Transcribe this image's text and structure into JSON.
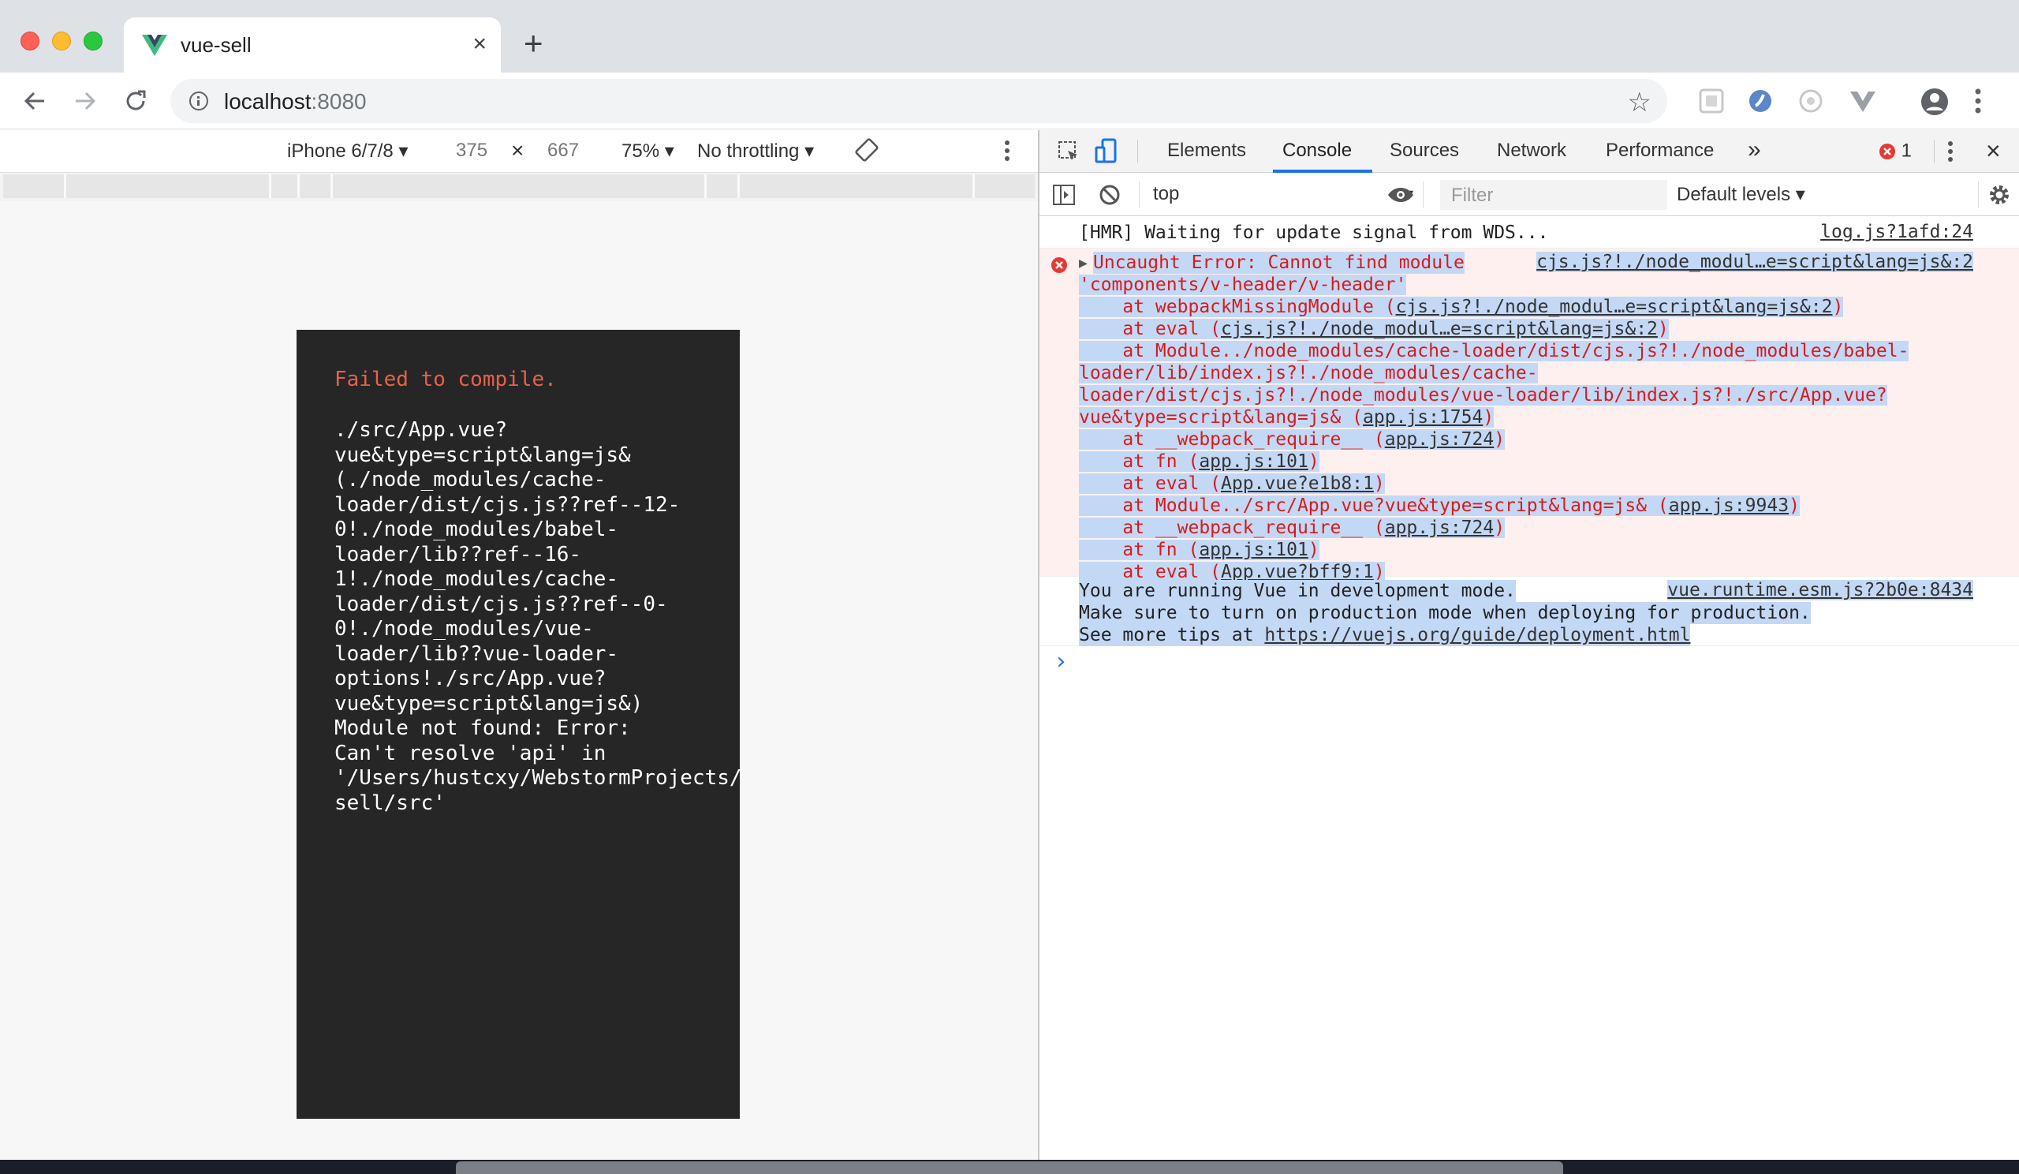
{
  "browser": {
    "tab_title": "vue-sell",
    "url_host": "localhost",
    "url_port": ":8080"
  },
  "device_toolbar": {
    "device": "iPhone 6/7/8",
    "width": "375",
    "times": "×",
    "height": "667",
    "zoom": "75%",
    "throttle": "No throttling"
  },
  "overlay": {
    "title": "Failed to compile.",
    "message": "./src/App.vue?\nvue&type=script&lang=js&\n(./node_modules/cache-\nloader/dist/cjs.js??ref--12-\n0!./node_modules/babel-\nloader/lib??ref--16-\n1!./node_modules/cache-\nloader/dist/cjs.js??ref--0-\n0!./node_modules/vue-\nloader/lib??vue-loader-\noptions!./src/App.vue?\nvue&type=script&lang=js&)\nModule not found: Error:\nCan't resolve 'api' in\n'/Users/hustcxy/WebstormProjects/vue-\nsell/src'"
  },
  "devtools": {
    "tabs": [
      "Elements",
      "Console",
      "Sources",
      "Network",
      "Performance"
    ],
    "more": "»",
    "error_count": "1",
    "context": "top",
    "filter_placeholder": "Filter",
    "levels": "Default levels"
  },
  "console": {
    "hmr": {
      "text": "[HMR] Waiting for update signal from WDS...",
      "source": "log.js?1afd:24"
    },
    "error": {
      "head": "Uncaught Error: Cannot find module",
      "head_source": "cjs.js?!./node_modul…e=script&lang=js&:2",
      "lines": [
        {
          "pre": "'components/v-header/v-header'",
          "link": "",
          "post": ""
        },
        {
          "pre": "    at webpackMissingModule (",
          "link": "cjs.js?!./node_modul…e=script&lang=js&:2",
          "post": ")"
        },
        {
          "pre": "    at eval (",
          "link": "cjs.js?!./node_modul…e=script&lang=js&:2",
          "post": ")"
        },
        {
          "pre": "    at Module../node_modules/cache-loader/dist/cjs.js?!./node_modules/babel-",
          "link": "",
          "post": ""
        },
        {
          "pre": "loader/lib/index.js?!./node_modules/cache-",
          "link": "",
          "post": ""
        },
        {
          "pre": "loader/dist/cjs.js?!./node_modules/vue-loader/lib/index.js?!./src/App.vue?",
          "link": "",
          "post": ""
        },
        {
          "pre": "vue&type=script&lang=js& (",
          "link": "app.js:1754",
          "post": ")"
        },
        {
          "pre": "    at __webpack_require__ (",
          "link": "app.js:724",
          "post": ")"
        },
        {
          "pre": "    at fn (",
          "link": "app.js:101",
          "post": ")"
        },
        {
          "pre": "    at eval (",
          "link": "App.vue?e1b8:1",
          "post": ")"
        },
        {
          "pre": "    at Module../src/App.vue?vue&type=script&lang=js& (",
          "link": "app.js:9943",
          "post": ")"
        },
        {
          "pre": "    at __webpack_require__ (",
          "link": "app.js:724",
          "post": ")"
        },
        {
          "pre": "    at fn (",
          "link": "app.js:101",
          "post": ")"
        },
        {
          "pre": "    at eval (",
          "link": "App.vue?bff9:1",
          "post": ")"
        }
      ]
    },
    "vue": {
      "line1": "You are running Vue in development mode.",
      "source": "vue.runtime.esm.js?2b0e:8434",
      "line2": "Make sure to turn on production mode when deploying for production.",
      "line3_pre": "See more tips at ",
      "line3_link": "https://vuejs.org/guide/deployment.html"
    },
    "prompt": "›"
  }
}
